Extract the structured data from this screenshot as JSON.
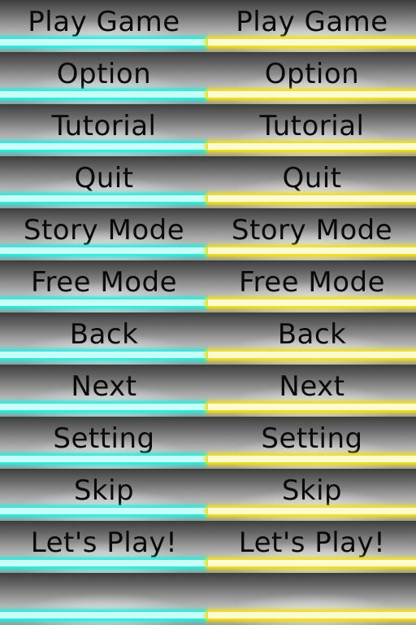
{
  "buttons": {
    "play_game": "Play Game",
    "option": "Option",
    "tutorial": "Tutorial",
    "quit": "Quit",
    "story_mode": "Story Mode",
    "free_mode": "Free Mode",
    "back": "Back",
    "next": "Next",
    "setting": "Setting",
    "skip": "Skip",
    "lets_play": "Let's Play!",
    "blank": ""
  },
  "colors": {
    "cyan_glow": "#26f2e0",
    "yellow_glow": "#f2e21a",
    "text": "#0a0a0a"
  }
}
